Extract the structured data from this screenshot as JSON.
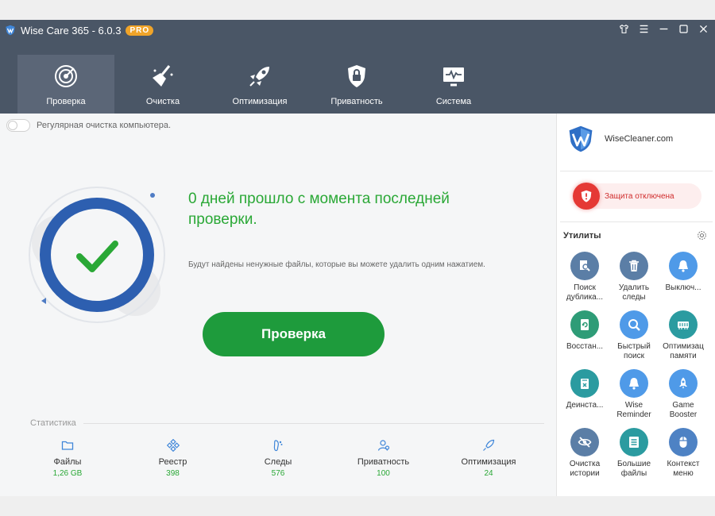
{
  "app": {
    "title": "Wise Care 365 - 6.0.3",
    "badge": "PRO",
    "accent": "#2aa836"
  },
  "nav": [
    {
      "label": "Проверка",
      "icon": "target-icon",
      "active": true
    },
    {
      "label": "Очистка",
      "icon": "broom-icon",
      "active": false
    },
    {
      "label": "Оптимизация",
      "icon": "rocket-icon",
      "active": false
    },
    {
      "label": "Приватность",
      "icon": "lock-shield-icon",
      "active": false
    },
    {
      "label": "Система",
      "icon": "monitor-icon",
      "active": false
    }
  ],
  "main": {
    "toggle_label": "Регулярная очистка компьютера.",
    "headline": "0 дней прошло с момента последней проверки.",
    "subtext": "Будут найдены ненужные файлы, которые вы можете удалить одним нажатием.",
    "scan_button": "Проверка"
  },
  "stats": {
    "title": "Статистика",
    "items": [
      {
        "label": "Файлы",
        "value": "1,26 GB",
        "icon": "folder-icon"
      },
      {
        "label": "Реестр",
        "value": "398",
        "icon": "registry-icon"
      },
      {
        "label": "Следы",
        "value": "576",
        "icon": "footprint-icon"
      },
      {
        "label": "Приватность",
        "value": "100",
        "icon": "user-icon"
      },
      {
        "label": "Оптимизация",
        "value": "24",
        "icon": "rocket-icon"
      }
    ]
  },
  "sidebar": {
    "brand": "WiseCleaner.com",
    "protection": "Защита отключена",
    "utilities_title": "Утилиты",
    "tools": [
      {
        "label": "Поиск\nдублика...",
        "icon": "duplicate-search-icon",
        "color": "blue"
      },
      {
        "label": "Удалить\nследы",
        "icon": "trash-icon",
        "color": "blue"
      },
      {
        "label": "Выключ...",
        "icon": "bell-icon",
        "color": "lb"
      },
      {
        "label": "Восстан...",
        "icon": "restore-icon",
        "color": "green"
      },
      {
        "label": "Быстрый\nпоиск",
        "icon": "magnifier-icon",
        "color": "lb"
      },
      {
        "label": "Оптимизац\nпамяти",
        "icon": "memory-icon",
        "color": "teal"
      },
      {
        "label": "Деинста...",
        "icon": "uninstall-icon",
        "color": "teal"
      },
      {
        "label": "Wise\nReminder",
        "icon": "bell-icon",
        "color": "lb"
      },
      {
        "label": "Game\nBooster",
        "icon": "rocket-icon",
        "color": "lb"
      },
      {
        "label": "Очистка\nистории",
        "icon": "eye-off-icon",
        "color": "blue"
      },
      {
        "label": "Большие\nфайлы",
        "icon": "big-files-icon",
        "color": "teal"
      },
      {
        "label": "Контекст\nменю",
        "icon": "mouse-icon",
        "color": "blue2"
      }
    ]
  }
}
